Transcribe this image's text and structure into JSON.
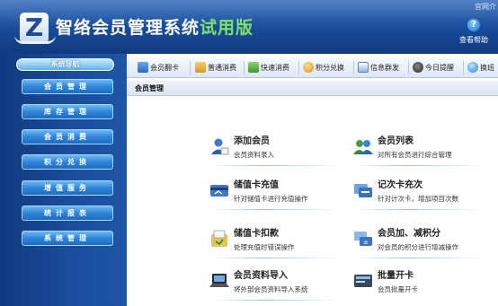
{
  "app": {
    "title_main": "智络会员管理系统",
    "title_trial": "试用版",
    "corner_text": "官网介",
    "help_label": "查看帮助"
  },
  "sidebar": {
    "title": "系统导航",
    "items": [
      {
        "label": "会员管理"
      },
      {
        "label": "库存管理"
      },
      {
        "label": "会员消费"
      },
      {
        "label": "积分兑换"
      },
      {
        "label": "增值服务"
      },
      {
        "label": "统计报表"
      },
      {
        "label": "系统管理"
      }
    ]
  },
  "toolbar": {
    "items": [
      {
        "label": "会员翻卡",
        "icon": "card-icon"
      },
      {
        "label": "普通消费",
        "icon": "cart-icon"
      },
      {
        "label": "快速消费",
        "icon": "quick-pay-icon"
      },
      {
        "label": "积分兑换",
        "icon": "points-icon"
      },
      {
        "label": "信息群发",
        "icon": "message-icon"
      },
      {
        "label": "今日提醒",
        "icon": "reminder-icon"
      },
      {
        "label": "换班",
        "icon": "shift-icon"
      }
    ]
  },
  "breadcrumb": "会员管理",
  "cards": [
    {
      "title": "添加会员",
      "desc": "会员资料录入",
      "icon": "add-member-icon"
    },
    {
      "title": "会员列表",
      "desc": "对所有会员进行综合管理",
      "icon": "member-list-icon"
    },
    {
      "title": "储值卡充值",
      "desc": "针对储值卡进行充值操作",
      "icon": "stored-card-recharge-icon"
    },
    {
      "title": "记次卡充次",
      "desc": "针对计次卡，增加项目次数",
      "icon": "count-card-recharge-icon"
    },
    {
      "title": "储值卡扣款",
      "desc": "处理充值时错误操作",
      "icon": "stored-card-deduct-icon"
    },
    {
      "title": "会员加、减积分",
      "desc": "对会员的积分进行增减操作",
      "icon": "points-adjust-icon"
    },
    {
      "title": "会员资料导入",
      "desc": "将外部会员资料导入系统",
      "icon": "import-icon"
    },
    {
      "title": "批量开卡",
      "desc": "会员批量开卡",
      "icon": "batch-card-icon"
    }
  ],
  "colors": {
    "header_bg": "#1a4f9e",
    "sidebar_bg": "#1a4d9c",
    "nav_button": "#2f85d8",
    "trial_text": "#7ee06a"
  }
}
